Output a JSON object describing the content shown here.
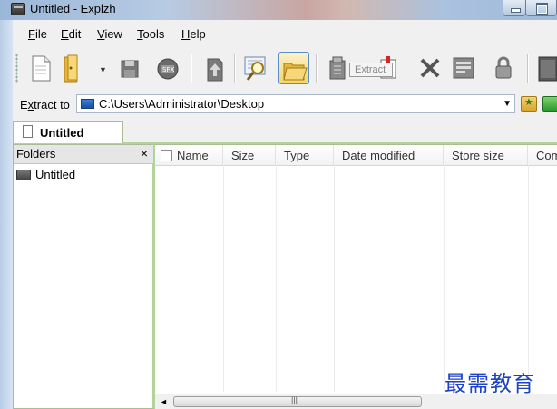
{
  "window": {
    "title": "Untitled - Explzh"
  },
  "menu": [
    {
      "label": "File",
      "mnemonic": "F",
      "rest": "ile"
    },
    {
      "label": "Edit",
      "mnemonic": "E",
      "rest": "dit"
    },
    {
      "label": "View",
      "mnemonic": "V",
      "rest": "iew"
    },
    {
      "label": "Tools",
      "mnemonic": "T",
      "rest": "ools"
    },
    {
      "label": "Help",
      "mnemonic": "H",
      "rest": "elp"
    }
  ],
  "toolbar": {
    "buttons": [
      "new-archive-icon",
      "open-folder-icon",
      "save-icon",
      "disk-icon",
      "upload-icon",
      "view-icon",
      "folder-open-icon",
      "extract-icon",
      "extract-to-icon",
      "delete-icon",
      "properties-icon",
      "lock-icon",
      "book-icon"
    ],
    "tooltip": "Extract"
  },
  "extract_bar": {
    "label": "Extract to",
    "label_mnemonic": "x",
    "path": "C:\\Users\\Administrator\\Desktop"
  },
  "tabs": [
    {
      "label": "Untitled"
    }
  ],
  "folders_panel": {
    "header": "Folders",
    "close": "×",
    "items": [
      {
        "label": "Untitled"
      }
    ]
  },
  "list": {
    "columns": [
      "Name",
      "Size",
      "Type",
      "Date modified",
      "Store size",
      "Com"
    ]
  },
  "watermark": "最需教育",
  "colors": {
    "accent_border": "#b4d39a",
    "active_button": "#f5d56b"
  }
}
